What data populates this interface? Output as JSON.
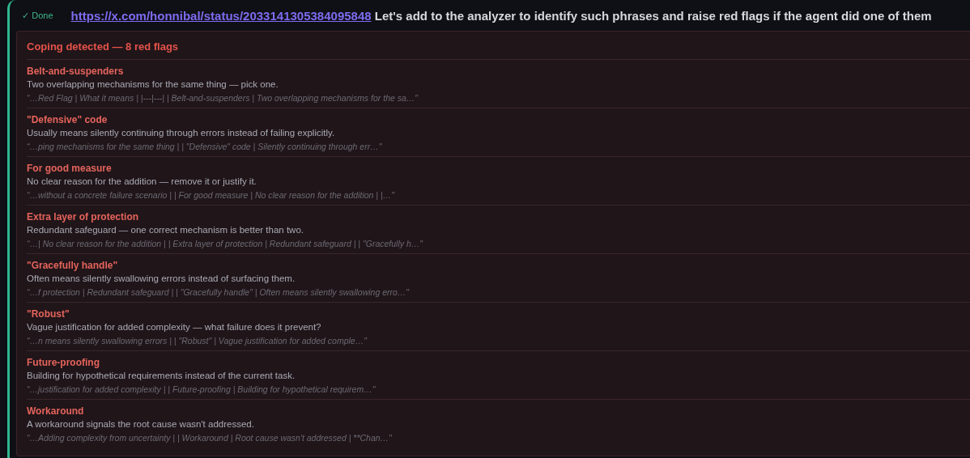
{
  "status": {
    "kind": "done",
    "label": "✓ Done"
  },
  "message": {
    "link": "https://x.com/honnibal/status/2033141305384095848",
    "text": "Let's add to the analyzer to identify such phrases and raise red flags if the agent did one of them"
  },
  "panel": {
    "title": "Coping detected — 8 red flags",
    "flags": [
      {
        "name": "Belt-and-suspenders",
        "meaning": "Two overlapping mechanisms for the same thing — pick one.",
        "excerpt": "“…Red Flag | What it means | |---|---| | Belt-and-suspenders | Two overlapping mechanisms for the sa…\""
      },
      {
        "name": "\"Defensive\" code",
        "meaning": "Usually means silently continuing through errors instead of failing explicitly.",
        "excerpt": "“…ping mechanisms for the same thing | | \"Defensive\" code | Silently continuing through err…\""
      },
      {
        "name": "For good measure",
        "meaning": "No clear reason for the addition — remove it or justify it.",
        "excerpt": "“…without a concrete failure scenario | | For good measure | No clear reason for the addition | |…\""
      },
      {
        "name": "Extra layer of protection",
        "meaning": "Redundant safeguard — one correct mechanism is better than two.",
        "excerpt": "“…| No clear reason for the addition | | Extra layer of protection | Redundant safeguard | | \"Gracefully h…\""
      },
      {
        "name": "\"Gracefully handle\"",
        "meaning": "Often means silently swallowing errors instead of surfacing them.",
        "excerpt": "“…f protection | Redundant safeguard | | \"Gracefully handle\" | Often means silently swallowing erro…\""
      },
      {
        "name": "\"Robust\"",
        "meaning": "Vague justification for added complexity — what failure does it prevent?",
        "excerpt": "“…n means silently swallowing errors | | \"Robust\" | Vague justification for added comple…\""
      },
      {
        "name": "Future-proofing",
        "meaning": "Building for hypothetical requirements instead of the current task.",
        "excerpt": "“…justification for added complexity | | Future-proofing | Building for hypothetical requirem…\""
      },
      {
        "name": "Workaround",
        "meaning": "A workaround signals the root cause wasn't addressed.",
        "excerpt": "“…Adding complexity from uncertainty | | Workaround | Root cause wasn't addressed | **Chan…\""
      }
    ]
  }
}
